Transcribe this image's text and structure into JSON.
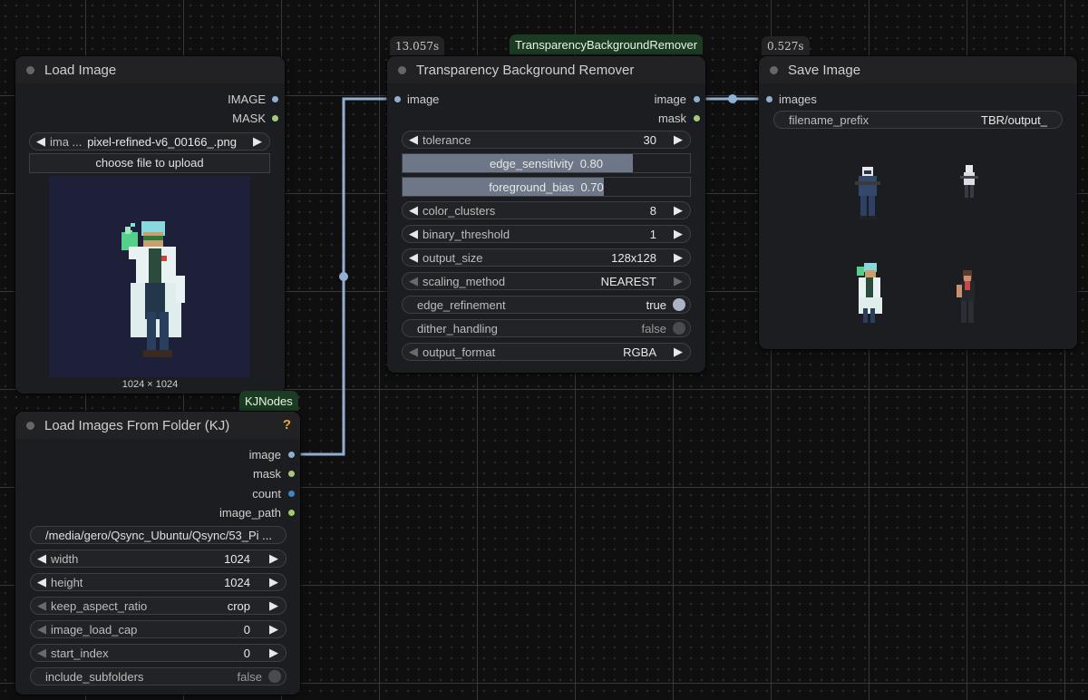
{
  "nodes": {
    "load_image": {
      "title": "Load Image",
      "outputs": [
        "IMAGE",
        "MASK"
      ],
      "image_label": "ima ...",
      "image_value": "pixel-refined-v6_00166_.png",
      "upload_label": "choose file to upload",
      "preview_size": "1024 × 1024"
    },
    "tbr": {
      "timing": "13.057s",
      "package": "TransparencyBackgroundRemover",
      "title": "Transparency Background Remover",
      "input": "image",
      "outputs": [
        "image",
        "mask"
      ],
      "widgets": {
        "tolerance": {
          "label": "tolerance",
          "value": "30"
        },
        "edge_sensitivity": {
          "label": "edge_sensitivity",
          "value": "0.80",
          "fraction": 0.8
        },
        "foreground_bias": {
          "label": "foreground_bias",
          "value": "0.70",
          "fraction": 0.7
        },
        "color_clusters": {
          "label": "color_clusters",
          "value": "8"
        },
        "binary_threshold": {
          "label": "binary_threshold",
          "value": "1"
        },
        "output_size": {
          "label": "output_size",
          "value": "128x128"
        },
        "scaling_method": {
          "label": "scaling_method",
          "value": "NEAREST"
        },
        "edge_refinement": {
          "label": "edge_refinement",
          "value": "true"
        },
        "dither_handling": {
          "label": "dither_handling",
          "value": "false"
        },
        "output_format": {
          "label": "output_format",
          "value": "RGBA"
        }
      }
    },
    "save_image": {
      "timing": "0.527s",
      "title": "Save Image",
      "input": "images",
      "filename_prefix_label": "filename_prefix",
      "filename_prefix_value": "TBR/output_"
    },
    "load_folder": {
      "package": "KJNodes",
      "title": "Load Images From Folder (KJ)",
      "help": "?",
      "outputs": [
        "image",
        "mask",
        "count",
        "image_path"
      ],
      "folder": "/media/gero/Qsync_Ubuntu/Qsync/53_Pi ...",
      "widgets": {
        "width": {
          "label": "width",
          "value": "1024"
        },
        "height": {
          "label": "height",
          "value": "1024"
        },
        "keep_aspect_ratio": {
          "label": "keep_aspect_ratio",
          "value": "crop"
        },
        "image_load_cap": {
          "label": "image_load_cap",
          "value": "0"
        },
        "start_index": {
          "label": "start_index",
          "value": "0"
        },
        "include_subfolders": {
          "label": "include_subfolders",
          "value": "false"
        }
      }
    }
  },
  "colors": {
    "link_image": "#8fb0d0",
    "slot_mask": "#a8c87a",
    "slot_count": "#3d86c6",
    "package_badge": "#1b3b22"
  },
  "icons": {
    "arrow_left": "◀",
    "arrow_right": "▶"
  }
}
